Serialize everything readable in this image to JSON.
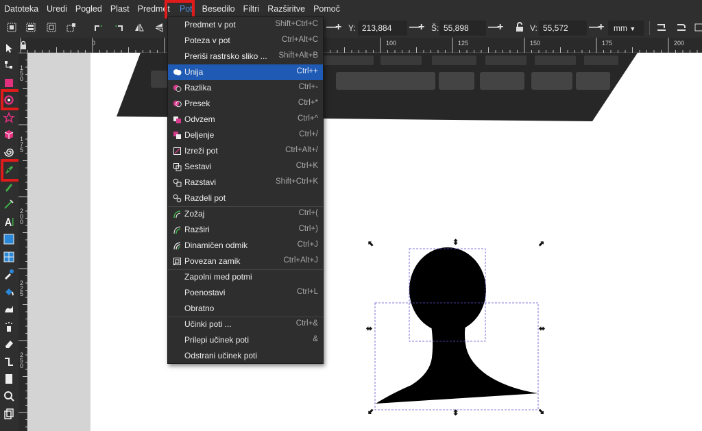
{
  "menubar": {
    "items": [
      "Datoteka",
      "Uredi",
      "Pogled",
      "Plast",
      "Predmet",
      "Pot",
      "Besedilo",
      "Filtri",
      "Razširitve",
      "Pomoč"
    ]
  },
  "toolbar": {
    "y_label": "Y:",
    "y_value": "213,884",
    "w_label": "Š:",
    "w_value": "55,898",
    "h_label": "V:",
    "h_value": "55,572",
    "unit": "mm",
    "plus": "+",
    "minus": "—"
  },
  "ruler": {
    "top_labels": [
      "0",
      "100",
      "125",
      "150",
      "175",
      "200"
    ],
    "left_labels": [
      "1 5 0",
      "1 7 5",
      "2 0 0",
      "2 2 5",
      "2 5 0"
    ]
  },
  "path_menu": {
    "items": [
      {
        "label": "Predmet v pot",
        "shortcut": "Shift+Ctrl+C",
        "icon": "none"
      },
      {
        "label": "Poteza v pot",
        "shortcut": "Ctrl+Alt+C",
        "icon": "none"
      },
      {
        "label": "Preriši rastrsko sliko ...",
        "shortcut": "Shift+Alt+B",
        "icon": "none"
      },
      {
        "label": "Unija",
        "shortcut": "Ctrl++",
        "icon": "union-icon"
      },
      {
        "label": "Razlika",
        "shortcut": "Ctrl+-",
        "icon": "difference-icon"
      },
      {
        "label": "Presek",
        "shortcut": "Ctrl+*",
        "icon": "intersection-icon"
      },
      {
        "label": "Odvzem",
        "shortcut": "Ctrl+^",
        "icon": "exclusion-icon"
      },
      {
        "label": "Deljenje",
        "shortcut": "Ctrl+/",
        "icon": "division-icon"
      },
      {
        "label": "Izreži pot",
        "shortcut": "Ctrl+Alt+/",
        "icon": "cut-path-icon"
      },
      {
        "label": "Sestavi",
        "shortcut": "Ctrl+K",
        "icon": "combine-icon"
      },
      {
        "label": "Razstavi",
        "shortcut": "Shift+Ctrl+K",
        "icon": "break-apart-icon"
      },
      {
        "label": "Razdeli pot",
        "shortcut": "",
        "icon": "split-path-icon"
      },
      {
        "label": "Zožaj",
        "shortcut": "Ctrl+(",
        "icon": "inset-icon"
      },
      {
        "label": "Razširi",
        "shortcut": "Ctrl+)",
        "icon": "outset-icon"
      },
      {
        "label": "Dinamičen odmik",
        "shortcut": "Ctrl+J",
        "icon": "dynamic-offset-icon"
      },
      {
        "label": "Povezan zamik",
        "shortcut": "Ctrl+Alt+J",
        "icon": "linked-offset-icon"
      },
      {
        "label": "Zapolni med potmi",
        "shortcut": "",
        "icon": "none"
      },
      {
        "label": "Poenostavi",
        "shortcut": "Ctrl+L",
        "icon": "none"
      },
      {
        "label": "Obratno",
        "shortcut": "",
        "icon": "none"
      },
      {
        "label": "Učinki poti ...",
        "shortcut": "Ctrl+&",
        "icon": "none"
      },
      {
        "label": "Prilepi učinek poti",
        "shortcut": "&",
        "icon": "none"
      },
      {
        "label": "Odstrani učinek poti",
        "shortcut": "",
        "icon": "none"
      }
    ],
    "selected_index": 3
  },
  "colors": {
    "accent": "#1f5bb5",
    "highlight": "#e01b1b",
    "boolean_icon": "#d63a8a"
  }
}
